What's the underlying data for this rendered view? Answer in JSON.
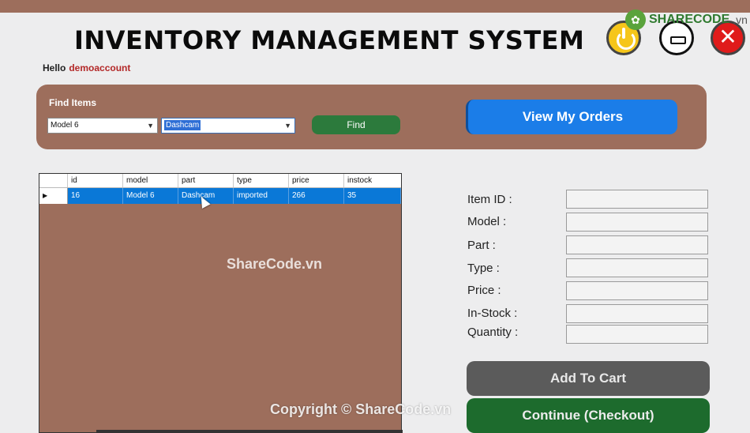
{
  "window": {
    "title": "INVENTORY MANAGEMENT SYSTEM"
  },
  "watermark": {
    "logo_text": "SHARECODE",
    "logo_suffix": ".vn",
    "center_text": "ShareCode.vn",
    "bottom_text": "Copyright © ShareCode.vn"
  },
  "controls": {
    "close_glyph": "✕"
  },
  "greeting": {
    "prefix": "Hello",
    "username": "demoaccount"
  },
  "find": {
    "label": "Find Items",
    "model_value": "Model 6",
    "part_value": "Dashcam",
    "button_label": "Find"
  },
  "orders_button_label": "View My Orders",
  "grid": {
    "columns": [
      "id",
      "model",
      "part",
      "type",
      "price",
      "instock"
    ],
    "rows": [
      {
        "selector": "▶",
        "id": "16",
        "model": "Model 6",
        "part": "Dashcam",
        "type": "imported",
        "price": "266",
        "instock": "35"
      }
    ]
  },
  "form": {
    "item_id_label": "Item ID :",
    "model_label": "Model :",
    "part_label": "Part :",
    "type_label": "Type :",
    "price_label": "Price :",
    "instock_label": "In-Stock :",
    "quantity_label": "Quantity :"
  },
  "actions": {
    "add_to_cart_label": "Add To Cart",
    "checkout_label": "Continue (Checkout)"
  },
  "colors": {
    "panel_brown": "#9d6e5c",
    "primary_blue": "#1b7de8",
    "find_green": "#2c7a3c",
    "checkout_green": "#1d6b2d",
    "add_gray": "#5b5b5b",
    "username_red": "#b32828"
  }
}
